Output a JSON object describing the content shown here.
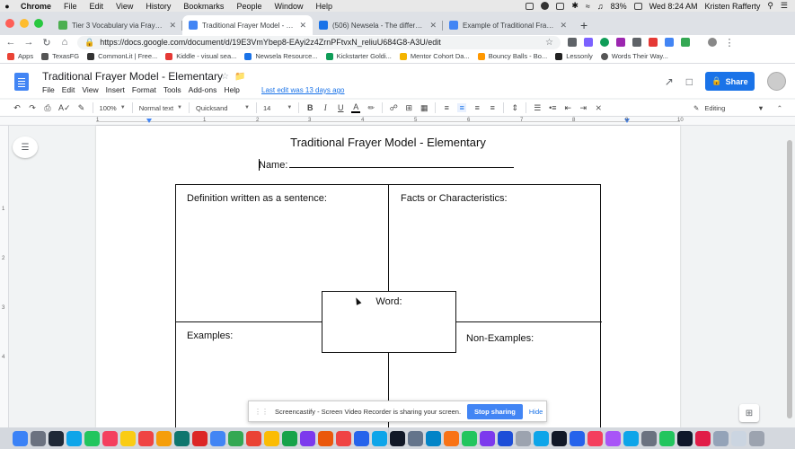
{
  "menubar": {
    "app": "Chrome",
    "items": [
      "File",
      "Edit",
      "View",
      "History",
      "Bookmarks",
      "People",
      "Window",
      "Help"
    ],
    "battery": "83%",
    "clock": "Wed 8:24 AM",
    "user": "Kristen Rafferty"
  },
  "tabs": [
    {
      "title": "Tier 3 Vocabulary via Frayer M",
      "color": "#4caf50"
    },
    {
      "title": "Traditional Frayer Model - Elem",
      "color": "#4285f4"
    },
    {
      "title": "(506) Newsela - The differenc",
      "color": "#1a73e8"
    },
    {
      "title": "Example of Traditional Frayer M",
      "color": "#4285f4"
    }
  ],
  "address": {
    "url": "https://docs.google.com/document/d/19E3VmYbep8-EAyi2z4ZrnPFtvxN_reliuU684G8-A3U/edit"
  },
  "bookmarks": [
    {
      "label": "Apps",
      "color": "#ea4335"
    },
    {
      "label": "TexasFG",
      "color": "#555555"
    },
    {
      "label": "CommonLit | Free...",
      "color": "#333333"
    },
    {
      "label": "Kiddle - visual sea...",
      "color": "#e53935"
    },
    {
      "label": "Newsela Resource...",
      "color": "#1a73e8"
    },
    {
      "label": "Kickstarter Goldi...",
      "color": "#0f9d58"
    },
    {
      "label": "Mentor Cohort Da...",
      "color": "#f4b400"
    },
    {
      "label": "Bouncy Balls - Bo...",
      "color": "#ff9800"
    },
    {
      "label": "Lessonly",
      "color": "#222222"
    },
    {
      "label": "Words Their Way...",
      "color": "#555555"
    }
  ],
  "docs": {
    "title": "Traditional Frayer Model - Elementary",
    "menu": [
      "File",
      "Edit",
      "View",
      "Insert",
      "Format",
      "Tools",
      "Add-ons",
      "Help"
    ],
    "last_edit": "Last edit was 13 days ago",
    "share_label": "Share"
  },
  "toolbar": {
    "zoom": "100%",
    "style": "Normal text",
    "font": "Quicksand",
    "size": "14",
    "mode": "Editing"
  },
  "ruler": {
    "numbers": [
      "1",
      "1",
      "2",
      "3",
      "4",
      "5",
      "6",
      "7",
      "8",
      "9",
      "10"
    ],
    "vertical": [
      "1",
      "2",
      "3",
      "4"
    ]
  },
  "document": {
    "heading": "Traditional Frayer Model - Elementary",
    "name_label": "Name:",
    "cell_definition": "Definition written as a sentence:",
    "cell_facts": "Facts or Characteristics:",
    "cell_examples": "Examples:",
    "cell_nonexamples": "Non-Examples:",
    "word_label": "Word:"
  },
  "screencastify": {
    "message": "Screencastify - Screen Video Recorder is sharing your screen.",
    "stop_label": "Stop sharing",
    "hide_label": "Hide"
  },
  "colors": {
    "accent": "#1a73e8",
    "docs_blue": "#4285f4"
  }
}
